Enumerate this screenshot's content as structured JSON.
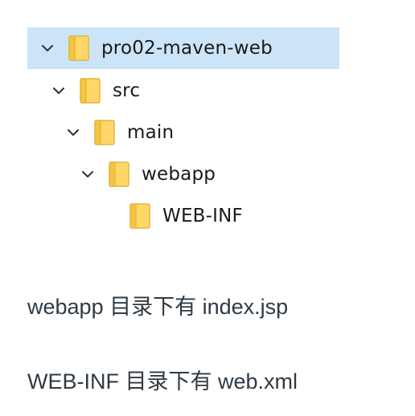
{
  "explorer": {
    "items": [
      {
        "label": "pro02-maven-web",
        "expanded": true,
        "selected": true,
        "icon": "folder-icon",
        "chevron": "chevron-down-icon"
      },
      {
        "label": "src",
        "expanded": true,
        "selected": false,
        "icon": "folder-icon",
        "chevron": "chevron-down-icon"
      },
      {
        "label": "main",
        "expanded": true,
        "selected": false,
        "icon": "folder-icon",
        "chevron": "chevron-down-icon"
      },
      {
        "label": "webapp",
        "expanded": true,
        "selected": false,
        "icon": "folder-icon",
        "chevron": "chevron-down-icon"
      },
      {
        "label": "WEB-INF",
        "expanded": false,
        "selected": false,
        "icon": "folder-icon",
        "chevron": ""
      }
    ],
    "colors": {
      "selection": "#cce4f7",
      "folder_fill": "#ffd766",
      "folder_edge": "#e0b53d",
      "chevron": "#3a3a3a"
    }
  },
  "notes": {
    "line1": "webapp 目录下有 index.jsp",
    "line2": "WEB-INF 目录下有 web.xml"
  }
}
